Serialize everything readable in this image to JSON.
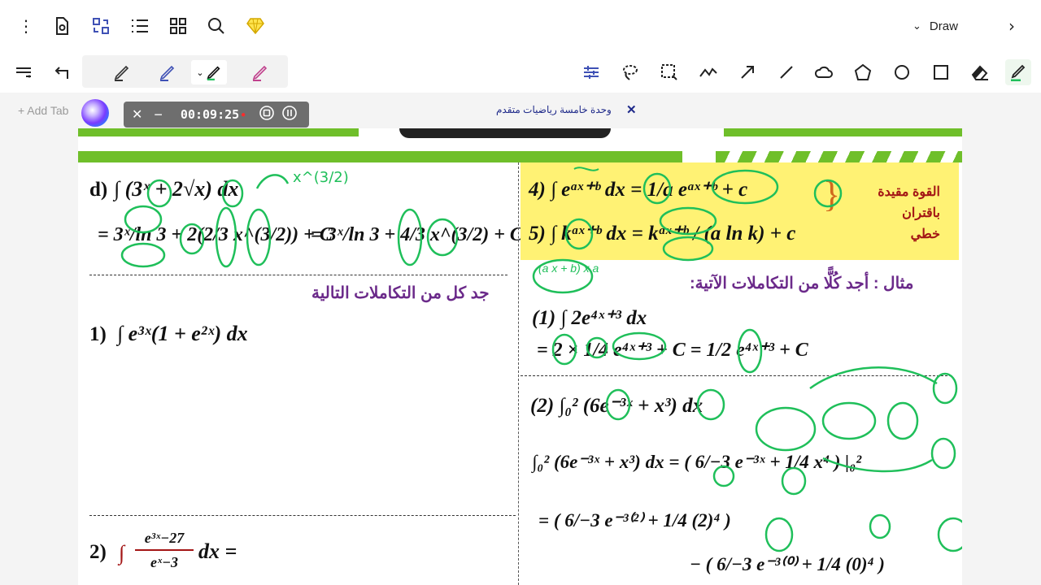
{
  "toolbar": {
    "left_icons": [
      "more-vert-icon",
      "page-settings-icon",
      "view-swap-icon",
      "list-icon",
      "grid-icon",
      "search-icon",
      "premium-diamond-icon"
    ],
    "mode_label": "Draw",
    "mode_chevron": "chevron-down-icon",
    "next_icon": "chevron-right-icon"
  },
  "tools": {
    "colors": {
      "green": "#1fbf5a",
      "blue": "#3f51b5",
      "pink": "#c0418d",
      "brand_green": "#6fbf2a"
    },
    "items": [
      "adjust-icon",
      "lasso-icon",
      "select-rect-icon",
      "freehand-icon",
      "arrow-icon",
      "line-icon",
      "cloud-icon",
      "pentagon-icon",
      "circle-icon",
      "rectangle-icon",
      "eraser-icon",
      "highlighter-icon"
    ]
  },
  "tabs": {
    "add_tab": "Add Tab",
    "timer": "00:09:25",
    "title": "وحدة خامسة رياضيات متقدم"
  },
  "content": {
    "left": {
      "d_label": "d)",
      "d_expr": "∫ (3ˣ + 2√x) dx",
      "d_note": "x^(3/2)",
      "d_result_lhs": "= 3ˣ/ln 3 + 2(2/3 x^(3/2)) + C",
      "d_result_rhs": "= 3ˣ/ln 3 + 4/3 x^(3/2) + C",
      "exercise_title": "جد كل من التكاملات التالية",
      "q1": "1)",
      "q1_expr": "∫ e³ˣ(1 + e²ˣ) dx",
      "q2": "2)",
      "q2_num": "e³ˣ−27",
      "q2_den": "eˣ−3",
      "q2_tail": "dx ="
    },
    "right": {
      "rule4": "4) ∫ eᵃˣ⁺ᵇ dx = 1/a eᵃˣ⁺ᵇ + c",
      "rule5": "5) ∫ kᵃˣ⁺ᵇ dx = kᵃˣ⁺ᵇ / (a ln k) + c",
      "rule_note": [
        "القوة مقيدة",
        "باقتران",
        "خطي"
      ],
      "example_title": "مثال : أجد كُلًّا من التكاملات الآتية:",
      "ex1": "(1) ∫ 2e⁴ˣ⁺³ dx",
      "ex1_step": "= 2 × 1/4 e⁴ˣ⁺³ + C  = 1/2 e⁴ˣ⁺³ + C",
      "ex2": "(2) ∫₀² (6e⁻³ˣ + x³) dx",
      "ex2_step1": "∫₀² (6e⁻³ˣ + x³) dx = ( 6/−3 e⁻³ˣ + 1/4 x⁴ ) |₀²",
      "ex2_step2": "= ( 6/−3 e⁻³⁽²⁾ + 1/4 (2)⁴ )",
      "ex2_step3": "− ( 6/−3 e⁻³⁽⁰⁾ + 1/4 (0)⁴ )",
      "ink_note": "(a x + b)  x a"
    }
  }
}
